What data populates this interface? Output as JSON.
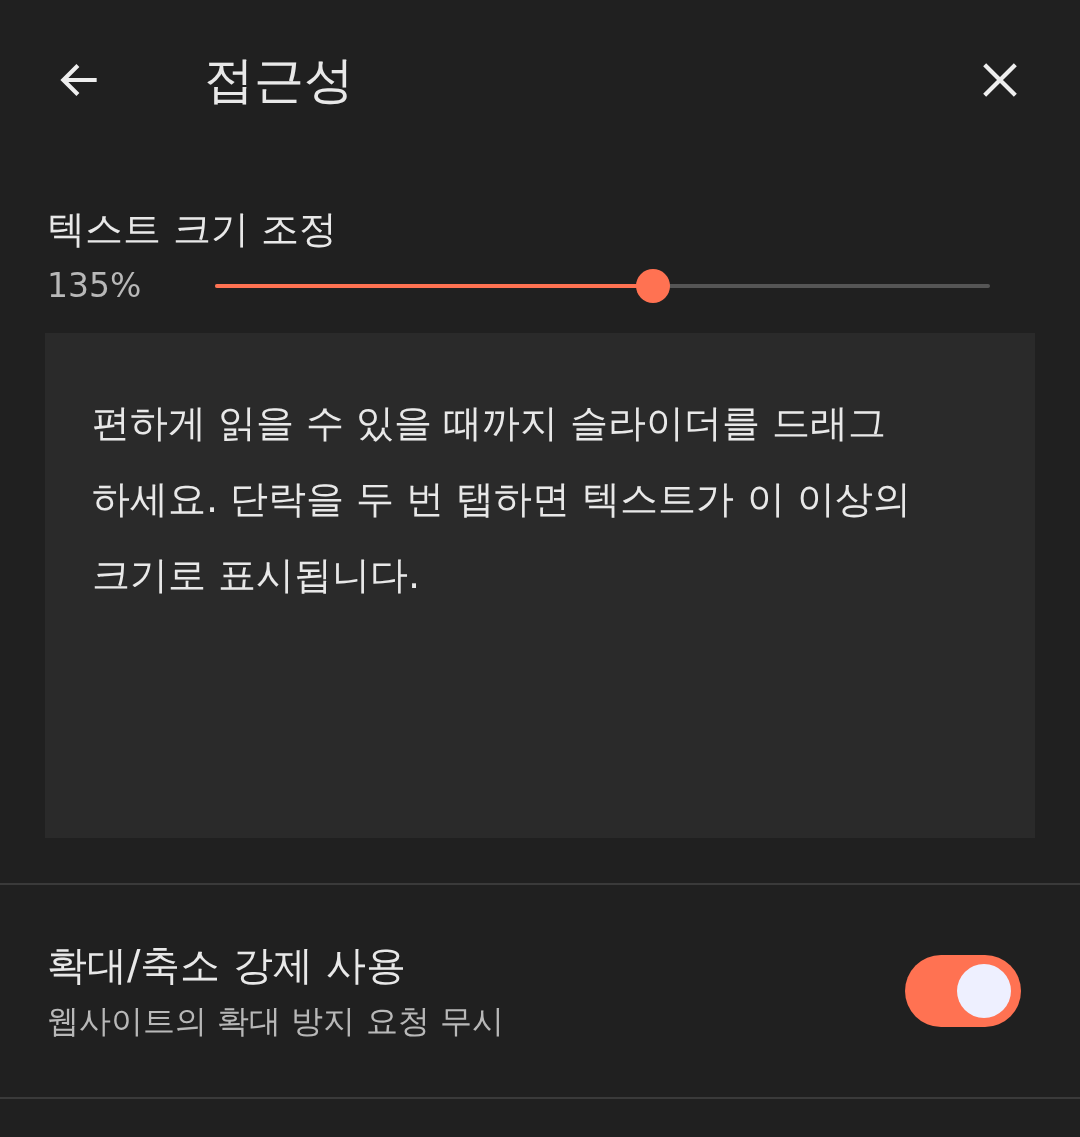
{
  "header": {
    "title": "접근성"
  },
  "text_scale": {
    "label": "텍스트 크기 조정",
    "reading": "135%",
    "level": 0.565
  },
  "preview": {
    "text": "편하게 읽을 수 있을 때까지 슬라이더를 드래그하세요. 단락을 두 번 탭하면 텍스트가 이 이상의 크기로 표시됩니다."
  },
  "settings": [
    {
      "kind": "toggle",
      "title": "확대/축소 강제 사용",
      "subtitle": "웹사이트의 확대 방지 요청 무시",
      "on": true
    }
  ]
}
